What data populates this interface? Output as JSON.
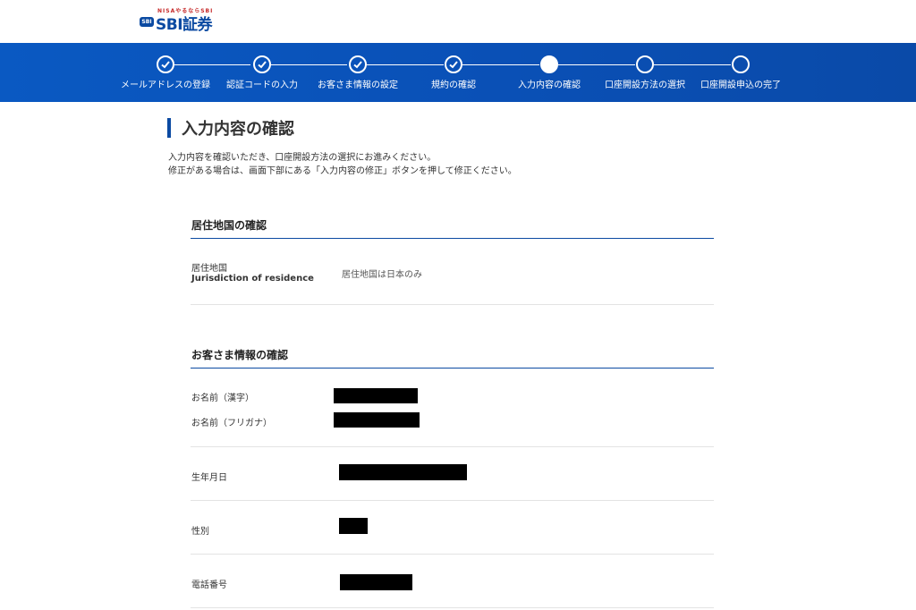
{
  "header": {
    "logo_nisa": "NISAやるならSBI",
    "logo_mark": "SBI",
    "logo_brand": "SBI証券"
  },
  "progress": {
    "steps": [
      {
        "label": "メールアドレスの登録",
        "state": "done"
      },
      {
        "label": "認証コードの入力",
        "state": "done"
      },
      {
        "label": "お客さま情報の設定",
        "state": "done"
      },
      {
        "label": "規約の確認",
        "state": "done"
      },
      {
        "label": "入力内容の確認",
        "state": "current"
      },
      {
        "label": "口座開設方法の選択",
        "state": "todo"
      },
      {
        "label": "口座開設申込の完了",
        "state": "todo"
      }
    ]
  },
  "page": {
    "title": "入力内容の確認",
    "intro_line1": "入力内容を確認いただき、口座開設方法の選択にお進みください。",
    "intro_line2": "修正がある場合は、画面下部にある「入力内容の修正」ボタンを押して修正ください。"
  },
  "residence": {
    "section_title": "居住地国の確認",
    "label": "居住地国",
    "sublabel": "Jurisdiction of residence",
    "value": "居住地国は日本のみ"
  },
  "customer": {
    "section_title": "お客さま情報の確認",
    "name_kanji_label": "お名前（漢字）",
    "name_kana_label": "お名前（フリガナ）",
    "birthdate_label": "生年月日",
    "gender_label": "性別",
    "phone_label": "電話番号"
  },
  "colors": {
    "brand_blue": "#0b4aa2",
    "band_blue": "#0a59c2",
    "redaction": "#000000"
  }
}
